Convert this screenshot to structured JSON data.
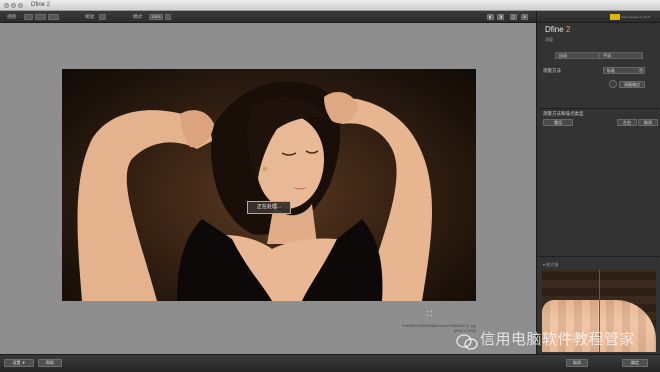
{
  "window": {
    "title": "Dfine 2"
  },
  "toolbar": {
    "view_label": "视图:",
    "view_btn_1": "",
    "view_btn_2": "",
    "view_btn_3": "",
    "zoom_label": "缩放:",
    "mode_label": "模式:",
    "mode_value": "100%",
    "icon_1": "◧",
    "icon_2": "◨",
    "icon_3": "◫",
    "icon_4": "⊞"
  },
  "canvas": {
    "processing_label": "正在处理...",
    "caption_line1": "7e3d9857d4f03f09fa87becad7285cd5171f   .jpg",
    "caption_line2": "(2000 x 1000)"
  },
  "panel": {
    "logo_text": "Nik Collection by DxO",
    "brand_name": "Dfine",
    "brand_num": " 2",
    "brand_sub": "测量",
    "seg_auto": "自动",
    "seg_manual": "手动",
    "preset_label": "测量方法",
    "preset_value": "标准",
    "btn_measure": "测量噪点",
    "section_title": "测量方法和噪点类型",
    "btn_reset": "重设",
    "btn_left": "左右",
    "btn_right": "取消",
    "magnifier_label": "▾ 放大镜"
  },
  "bottom": {
    "btn_settings": "设置 ▼",
    "btn_help": "帮助",
    "btn_cancel": "取消",
    "btn_ok": "确定"
  },
  "watermark": {
    "text": "信用电脑软件教程管家"
  },
  "icons": {
    "fullscreen": "fullscreen-icon",
    "wechat": "wechat-icon"
  }
}
